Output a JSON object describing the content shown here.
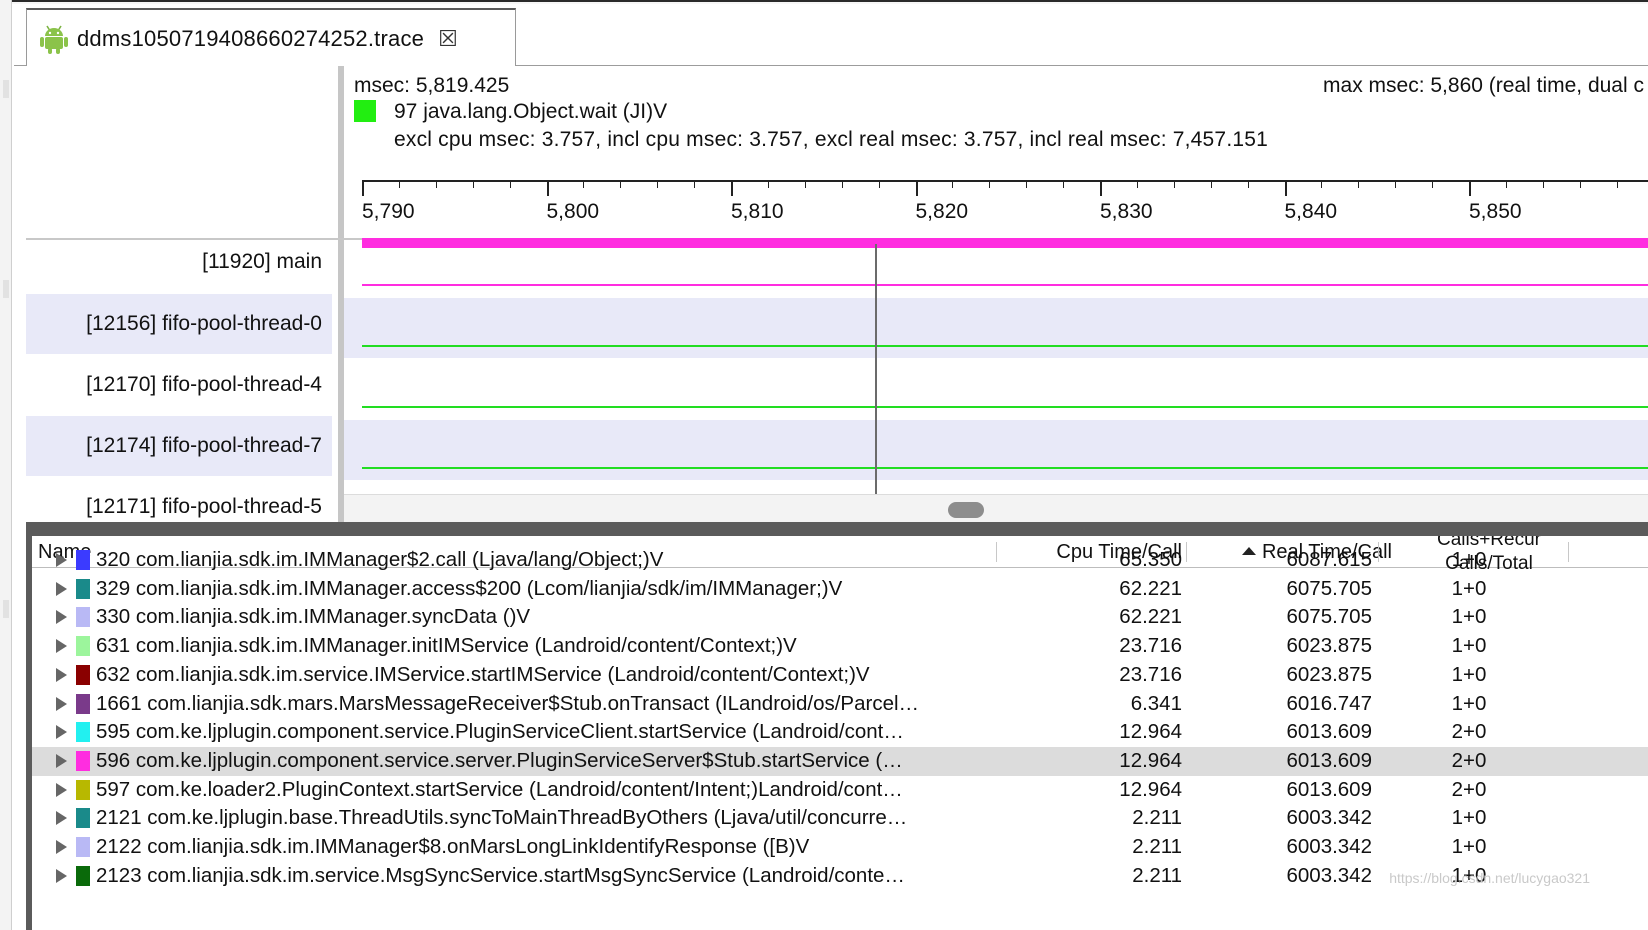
{
  "tab": {
    "title": "ddms1050719408660274252.trace",
    "close_glyph": "☒",
    "icon": "android-icon"
  },
  "timeline": {
    "msec_label": "msec: 5,819.425",
    "max_msec_label": "max msec: 5,860 (real time, dual c",
    "method_color": "#22ee11",
    "method_label": "97 java.lang.Object.wait (JI)V",
    "stats_label": "excl cpu msec: 3.757, incl cpu msec: 3.757, excl real msec: 3.757, incl real msec: 7,457.151",
    "axis_ticks": [
      "5,790",
      "5,800",
      "5,810",
      "5,820",
      "5,830",
      "5,840",
      "5,850"
    ],
    "threads": [
      {
        "name": "[11920] main",
        "color": "#ff2de0"
      },
      {
        "name": "[12156] fifo-pool-thread-0",
        "color": "#22dd22"
      },
      {
        "name": "[12170] fifo-pool-thread-4",
        "color": "#22dd22"
      },
      {
        "name": "[12174] fifo-pool-thread-7",
        "color": "#22dd22"
      },
      {
        "name": "[12171] fifo-pool-thread-5",
        "color": "#22dd22"
      }
    ]
  },
  "table": {
    "headers": {
      "name": "Name",
      "cpu": "Cpu Time/Call",
      "real": "Real Time/Call",
      "calls_line1": "Calls+Recur",
      "calls_line2": "Calls/Total"
    },
    "rows": [
      {
        "color": "#3b3bff",
        "name": "320 com.lianjia.sdk.im.IMManager$2.call (Ljava/lang/Object;)V",
        "cpu": "65.350",
        "real": "6087.615",
        "calls": "1+0"
      },
      {
        "color": "#1a8a8a",
        "name": "329 com.lianjia.sdk.im.IMManager.access$200 (Lcom/lianjia/sdk/im/IMManager;)V",
        "cpu": "62.221",
        "real": "6075.705",
        "calls": "1+0"
      },
      {
        "color": "#b9b9f5",
        "name": "330 com.lianjia.sdk.im.IMManager.syncData ()V",
        "cpu": "62.221",
        "real": "6075.705",
        "calls": "1+0"
      },
      {
        "color": "#9cf59c",
        "name": "631 com.lianjia.sdk.im.IMManager.initIMService (Landroid/content/Context;)V",
        "cpu": "23.716",
        "real": "6023.875",
        "calls": "1+0"
      },
      {
        "color": "#8a0000",
        "name": "632 com.lianjia.sdk.im.service.IMService.startIMService (Landroid/content/Context;)V",
        "cpu": "23.716",
        "real": "6023.875",
        "calls": "1+0"
      },
      {
        "color": "#7a3a8a",
        "name": "1661 com.lianjia.sdk.mars.MarsMessageReceiver$Stub.onTransact (ILandroid/os/Parcel…",
        "cpu": "6.341",
        "real": "6016.747",
        "calls": "1+0"
      },
      {
        "color": "#22f0f0",
        "name": "595 com.ke.ljplugin.component.service.PluginServiceClient.startService (Landroid/cont…",
        "cpu": "12.964",
        "real": "6013.609",
        "calls": "2+0"
      },
      {
        "color": "#ff2de0",
        "name": "596 com.ke.ljplugin.component.service.server.PluginServiceServer$Stub.startService (…",
        "cpu": "12.964",
        "real": "6013.609",
        "calls": "2+0",
        "selected": true
      },
      {
        "color": "#b8b800",
        "name": "597 com.ke.loader2.PluginContext.startService (Landroid/content/Intent;)Landroid/cont…",
        "cpu": "12.964",
        "real": "6013.609",
        "calls": "2+0"
      },
      {
        "color": "#1a8a8a",
        "name": "2121 com.ke.ljplugin.base.ThreadUtils.syncToMainThreadByOthers (Ljava/util/concurre…",
        "cpu": "2.211",
        "real": "6003.342",
        "calls": "1+0"
      },
      {
        "color": "#b9b9f5",
        "name": "2122 com.lianjia.sdk.im.IMManager$8.onMarsLongLinkIdentifyResponse ([B)V",
        "cpu": "2.211",
        "real": "6003.342",
        "calls": "1+0"
      },
      {
        "color": "#0a6a0a",
        "name": "2123 com.lianjia.sdk.im.service.MsgSyncService.startMsgSyncService (Landroid/conte…",
        "cpu": "2.211",
        "real": "6003.342",
        "calls": "1+0"
      }
    ]
  },
  "watermark": "https://blog.csdn.net/lucygao321"
}
